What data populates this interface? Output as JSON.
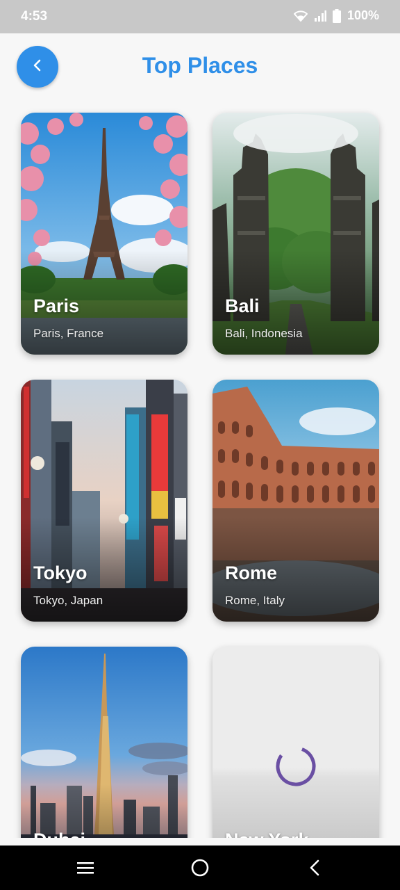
{
  "status_bar": {
    "time": "4:53",
    "battery": "100%",
    "icons": [
      "wifi-icon",
      "signal-icon",
      "battery-icon"
    ]
  },
  "app_bar": {
    "title": "Top Places",
    "back_icon": "chevron-left-icon",
    "accent_color": "#2f8fe8"
  },
  "places": [
    {
      "name": "Paris",
      "subtitle": "Paris, France"
    },
    {
      "name": "Bali",
      "subtitle": "Bali, Indonesia"
    },
    {
      "name": "Tokyo",
      "subtitle": "Tokyo, Japan"
    },
    {
      "name": "Rome",
      "subtitle": "Rome, Italy"
    },
    {
      "name": "Dubai",
      "subtitle": ""
    },
    {
      "name": "New York",
      "subtitle": "",
      "loading": true
    }
  ],
  "spinner_color": "#6a4fa3",
  "nav_bar": {
    "icons": [
      "menu-icon",
      "home-circle-icon",
      "back-arrow-icon"
    ]
  }
}
